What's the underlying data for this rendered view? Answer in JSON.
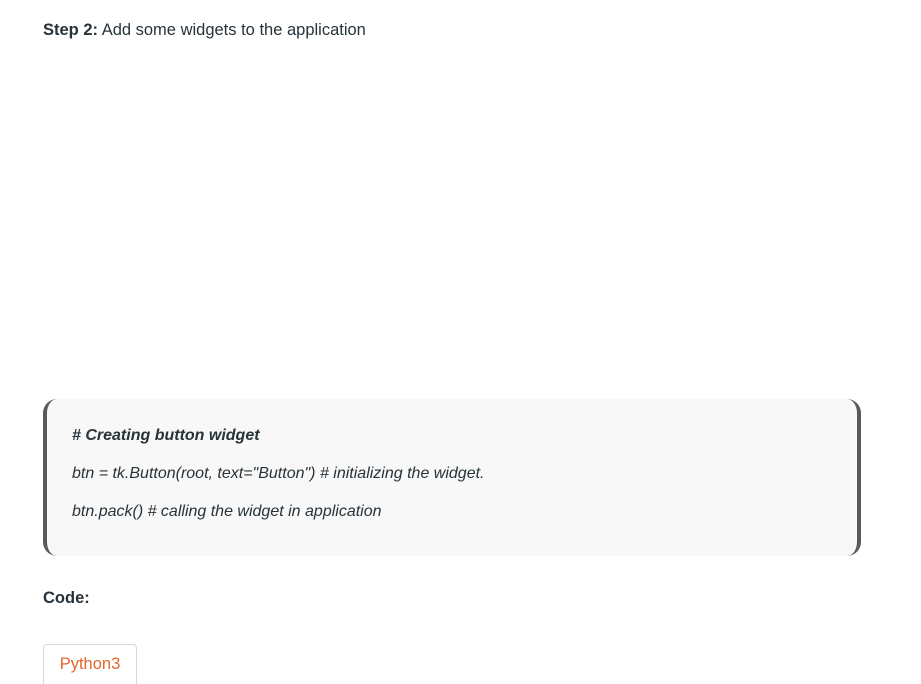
{
  "step": {
    "label": "Step 2:",
    "text": " Add some widgets to the application"
  },
  "code_block": {
    "lines": [
      "# Creating button widget",
      "btn = tk.Button(root, text=\"Button\") # initializing the widget.",
      "btn.pack() # calling the widget in application"
    ]
  },
  "code_section": {
    "label": "Code:",
    "tab_label": "Python3"
  }
}
